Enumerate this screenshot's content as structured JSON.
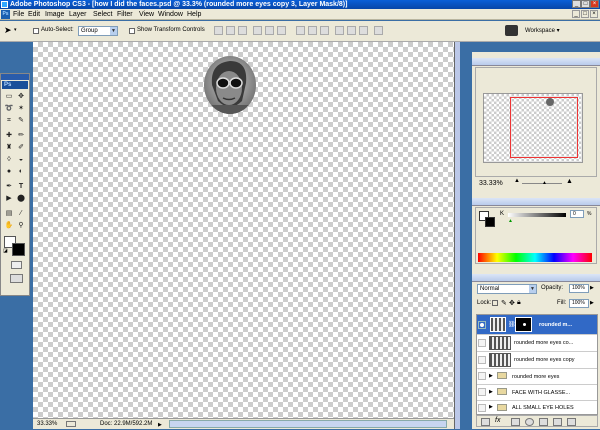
{
  "window": {
    "title": "Adobe Photoshop CS3 - [how I did the faces.psd @ 33.3% (rounded more eyes copy 3, Layer Mask/8)]",
    "controls": [
      "_",
      "□",
      "×"
    ]
  },
  "menu": [
    "File",
    "Edit",
    "Image",
    "Layer",
    "Select",
    "Filter",
    "View",
    "Window",
    "Help"
  ],
  "options": {
    "auto_select_label": "Auto-Select:",
    "auto_select_value": "Group",
    "transform_label": "Show Transform Controls",
    "workspace": "Workspace ▾"
  },
  "toolbox": {
    "logo": "Ps",
    "tools": [
      "marquee",
      "move",
      "lasso",
      "magic-wand",
      "crop",
      "slice",
      "healing",
      "brush",
      "stamp",
      "history-brush",
      "eraser",
      "bucket",
      "blur",
      "dodge",
      "pen",
      "type",
      "path-select",
      "shape",
      "notes",
      "eyedropper",
      "hand",
      "zoom"
    ]
  },
  "document": {
    "zoom": "33.33%",
    "doc_size": "Doc: 22.9M/592.2M"
  },
  "navigator": {
    "zoom": "33.33%"
  },
  "color": {
    "channel": "K",
    "value": "0",
    "unit": "%"
  },
  "layers": {
    "blend_mode": "Normal",
    "opacity_label": "Opacity:",
    "opacity": "100%",
    "lock_label": "Lock:",
    "fill_label": "Fill:",
    "fill": "100%",
    "items": [
      {
        "name": "rounded m...",
        "type": "masked",
        "selected": true
      },
      {
        "name": "rounded more eyes co...",
        "type": "layer"
      },
      {
        "name": "rounded more eyes copy",
        "type": "layer"
      },
      {
        "name": "rounded more eyes",
        "type": "group"
      },
      {
        "name": "FACE WITH GLASSE...",
        "type": "group"
      },
      {
        "name": "ALL SMALL EYE HOLES",
        "type": "group"
      }
    ]
  },
  "colors": {
    "accent": "#0a5fd8",
    "selected_layer": "#3169c6"
  }
}
